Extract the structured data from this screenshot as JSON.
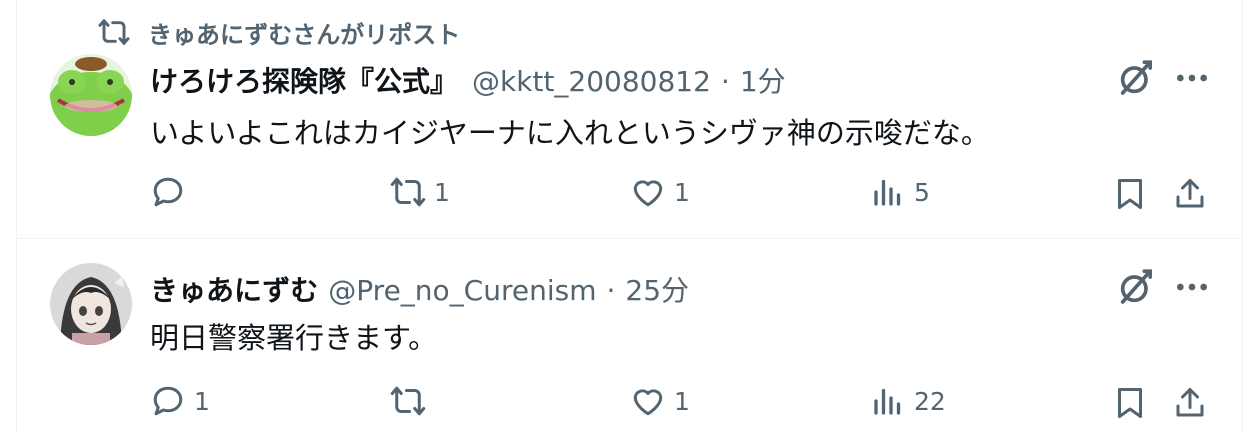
{
  "repost_banner": {
    "text": "きゅあにずむさんがリポスト"
  },
  "tweets": [
    {
      "name": "けろけろ探険隊『公式』",
      "handle": "@kktt_20080812",
      "separator": "·",
      "time": "1分",
      "text": "いよいよこれはカイジヤーナに入れというシヴァ神の示唆だな。",
      "reply_count": "",
      "retweet_count": "1",
      "like_count": "1",
      "view_count": "5"
    },
    {
      "name": "きゅあにずむ",
      "handle": "@Pre_no_Curenism",
      "separator": "·",
      "time": "25分",
      "text": "明日警察署行きます。",
      "reply_count": "1",
      "retweet_count": "",
      "like_count": "1",
      "view_count": "22"
    }
  ],
  "colors": {
    "text": "#0f1419",
    "secondary": "#536471",
    "border": "#eff3f4"
  },
  "icons": [
    "retweet-icon",
    "grok-icon",
    "more-icon",
    "reply-icon",
    "like-icon",
    "views-icon",
    "bookmark-icon",
    "share-icon"
  ]
}
